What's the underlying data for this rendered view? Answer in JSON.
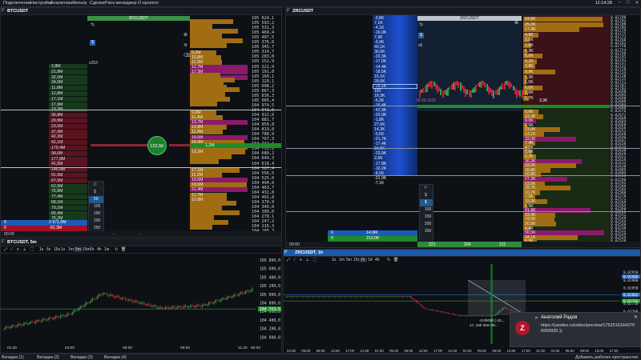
{
  "menu": {
    "items": [
      "Подключение",
      "Настройки",
      "Аналитика",
      "Фильтр",
      "Сделки",
      "Риск-менеджер",
      "О проекте"
    ],
    "clock": "12:14:28"
  },
  "btc_dom": {
    "title": "BTCUSDT",
    "bar_title": "BTCUSDT",
    "label_x": "x253",
    "left_values": [
      "2,8M",
      "21,8M",
      "32,0M",
      "34,0M",
      "11,8M",
      "12,8M",
      "17,1M",
      "17,9M",
      "19,2M",
      "30,8M",
      "29,9M",
      "23,5M",
      "37,9M",
      "42,2M",
      "42,1M",
      "179,4M",
      "98,0M",
      "177,8M",
      "41,5M",
      "140,9M",
      "91,5M",
      "67,5M",
      "62,5M",
      "76,8M",
      "77,4M",
      "68,1M",
      "70,1M",
      "89,4M",
      "76,2M",
      "59,7M",
      "69,0M"
    ],
    "prices": [
      "105 624,1",
      "105 593,2",
      "105 531,3",
      "105 469,4",
      "105 407,5",
      "105 376,6",
      "105 345,7",
      "105 314,7",
      "105 283,8",
      "105 252,9",
      "105 221,9",
      "105 191,0",
      "105 160,1",
      "105 129,1",
      "105 098,2",
      "105 067,3",
      "105 036,3",
      "105 005,4",
      "104 974,5",
      "104 943,6",
      "104 912,6",
      "104 881,7",
      "104 850,8",
      "104 819,8",
      "104 788,9",
      "104 767,3",
      "104 742,1",
      "104 711,2",
      "104 680,2",
      "104 649,3",
      "104 618,4",
      "104 587,4",
      "104 556,5",
      "104 525,6",
      "104 494,6",
      "104 463,7",
      "104 432,8",
      "104 401,8",
      "104 370,9",
      "104 340,0",
      "104 309,0",
      "104 278,1",
      "104 247,2",
      "104 216,3",
      "104 185,3"
    ],
    "volumes_top": [
      "9,2M",
      "10,8M",
      "11,0M",
      "12,7M",
      "17,3M",
      "12,7M",
      "11,8M",
      "12,7M"
    ],
    "volumes_mid": [
      "9,2M",
      "11,4M",
      "13,7M",
      "12,8M",
      "11,4M",
      "18,5M",
      "18,9M",
      "21,9M",
      "19,2M"
    ],
    "volumes_low": [
      "17,1M",
      "11,2M",
      "19,6M",
      "19,6M",
      "21,4M",
      "12,7M",
      "12,8M"
    ],
    "bubble": "122,5K",
    "level_label": "1,2M",
    "mini_header": "D",
    "mini_options": [
      "$",
      "50",
      "100",
      "150",
      "200",
      "250"
    ],
    "mini_selected": "50",
    "bottom": [
      {
        "label": "0",
        "value": "2 671,5M"
      },
      {
        "label": "0",
        "value": "-92,3M"
      }
    ],
    "footer": [
      "00:00",
      "-",
      "-"
    ]
  },
  "zrc_dom": {
    "title": "ZRCUSDT",
    "bar_title": "ZRCUSDT",
    "label_x": "x6",
    "left_values": [
      "-9,8K",
      "7,1K",
      "-4,1K",
      "-16,0K",
      "7,9K",
      "-5,9K",
      "40,1K",
      "36,6K",
      "-22,3K",
      "-17,0K",
      "-14,4K",
      "-18,5K",
      "15,1K",
      "28,6K",
      "-15,1K",
      "182",
      "18,3K",
      "-5,3K",
      "-16,4K",
      "-42,9K",
      "-29,9K",
      "-1,8K",
      "27,6K",
      "14,3K",
      "-5,6K",
      "-21,7K",
      "-17,4K",
      "16,5K",
      "-23,9K",
      "2,6K",
      "-17,8K",
      "-10,2K",
      "-8,5K",
      "-21,9K",
      "-7,1K"
    ],
    "prices": [
      "0,02796",
      "0,02792",
      "0,02788",
      "0,02783",
      "0,02779",
      "0,02775",
      "0,02771",
      "0,02766",
      "0,02762",
      "0,02758",
      "0,02754",
      "0,02749",
      "0,02745",
      "0,02741",
      "0,02737",
      "0,02732",
      "0,02728",
      "0,02724",
      "0,02720",
      "0,02715",
      "0,02711",
      "0,02707",
      "0,02703",
      "0,02698",
      "0,02694",
      "0,02690",
      "0,02688",
      "0,02684",
      "0,02680",
      "0,02676",
      "0,02672",
      "0,02668",
      "0,02664",
      "0,02660",
      "0,02656",
      "0,02652",
      "0,02648",
      "0,02646",
      "0,02642",
      "0,02638",
      "0,02634",
      "0,02630",
      "0,02626",
      "0,02622",
      "0,02618",
      "0,02614",
      "0,02610",
      "0,02606",
      "0,02604",
      "0,02600",
      "0,02596",
      "0,02592",
      "0,02588",
      "0,02584",
      "0,02580",
      "0,02576",
      "0,02572",
      "0,02568",
      "0,02564",
      "0,02560",
      "0,02556",
      "0,02552",
      "0,02548",
      "0,02544",
      "0,02540",
      "0,02536",
      "0,02532",
      "0,02528",
      "0,02524",
      "0,02520",
      "0,02516",
      "0,02512",
      "0,02508"
    ],
    "volumes_top": [
      "24,8K",
      "25,0K",
      "17,4K",
      "4,8K",
      "2,0K",
      "2,6K",
      "1,3K",
      "6,0K",
      "4,2K",
      "3,8K",
      "9,9K",
      "1,3K",
      "1,0K",
      "6,0K",
      "1,6K",
      "1,7K"
    ],
    "volumes_bottom": [
      "9,6K",
      "12,4K",
      "8,0K",
      "2,5K",
      "23,0K",
      "13,1K",
      "33,0K",
      "7,4K",
      "4,2K",
      "5,6K",
      "8,2K",
      "36,3K",
      "33,2K",
      "16,8K",
      "10,8K",
      "27,3K",
      "13,5K",
      "29,7K",
      "10,7K",
      "7,5K",
      "15,0K",
      "2,5K",
      "41,9K",
      "19,9K",
      "19,5K",
      "20,5K",
      "4,4K",
      "50,5K",
      "34,1K",
      "8,5K",
      "4,9K"
    ],
    "current_volume": "3,3K",
    "date_text": "18.06.2025",
    "mini_header": "F",
    "mini_options": [
      "$",
      "$",
      "100",
      "150",
      "200",
      "250"
    ],
    "mini_selected": "$",
    "bottom": [
      {
        "label": "0",
        "value": "14,9M"
      },
      {
        "label": "0",
        "value": "213,0K"
      }
    ],
    "footer": [
      "221",
      "204",
      "211"
    ],
    "footer_left": "00:00"
  },
  "btc_chart": {
    "title": "BTCUSDT, 5m",
    "timeframes": [
      "1s",
      "5s",
      "15s",
      "1s",
      "1m",
      "5m",
      "15m",
      "1h",
      "4h",
      "1w"
    ],
    "active_tf": "5m",
    "price_labels": [
      "105 800,0",
      "105 600,0",
      "105 400,0",
      "105 200,0",
      "105 000,0",
      "104 800,0",
      "104 600,0",
      "104 400,0",
      "104 200,0",
      "104 000,0"
    ],
    "current_price": "104 763,3",
    "current_tag": "104 753,5",
    "time_labels": [
      "01:30",
      "04:00",
      "06:30",
      "09:00",
      "11:30"
    ],
    "axis_time": "00:30"
  },
  "zrc_chart": {
    "title": "ZRCUSDT, 1h",
    "timeframes": [
      "1s",
      "1m",
      "5m",
      "15m",
      "1h",
      "1d",
      "4h"
    ],
    "active_tf": "1h",
    "price_labels": [
      "0,02950",
      "0,02900",
      "0,02850",
      "0,02800",
      "0,02750",
      "0,02700",
      "0,02650",
      "0,02600",
      "0,02550",
      "0,02500"
    ],
    "price_tags": [
      "0,02906",
      "0,02802",
      "0,02766",
      "0,02656",
      "0,02658"
    ],
    "time_labels": [
      "01:00",
      "05:00",
      "09:00",
      "13:00",
      "17:00",
      "21:00",
      "01:00",
      "05:00",
      "09:00",
      "13:00",
      "17:00",
      "21:00",
      "01:00",
      "05:00",
      "09:00",
      "13:00",
      "17:00",
      "21:00",
      "01:00",
      "05:00",
      "09:00",
      "13:00",
      "17:00"
    ],
    "measure_text": "-0,00030 (-10,...",
    "measure_text2": "17, 16h 00m 00..."
  },
  "notification": {
    "sender": "Анатолий Радов",
    "url": "https://yandex.ru/video/preview/17525161643706959935 ))",
    "avatar": "Z"
  },
  "taskbar": {
    "tabs": [
      "Вкладка (1)",
      "Вкладка (2)",
      "Вкладка (3)",
      "Вкладка (4)"
    ],
    "right_text": "Добавить рабочее пространство"
  },
  "colors": {
    "ask_bar": "#b8860b",
    "ask_big": "#8b1a6b",
    "bid_bar": "#9b6b14",
    "green": "#1e8b2b",
    "red": "#b0142a",
    "blue": "#1f4fb0"
  }
}
